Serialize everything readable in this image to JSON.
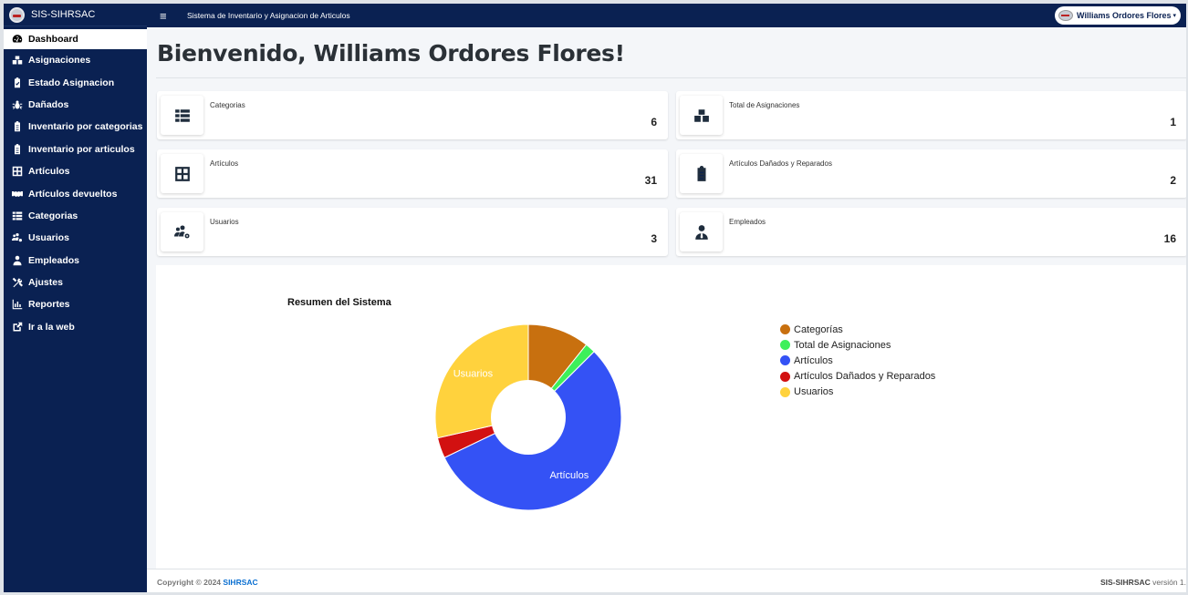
{
  "brand": {
    "name": "SIS-SIHRSAC"
  },
  "topbar": {
    "title": "Sistema de Inventario y Asignacion de Articulos",
    "user_name": "Williams Ordores Flores"
  },
  "sidebar": {
    "items": [
      {
        "label": "Dashboard",
        "icon": "tachometer-icon"
      },
      {
        "label": "Asignaciones",
        "icon": "boxes-icon"
      },
      {
        "label": "Estado Asignacion",
        "icon": "clipboard-check-icon"
      },
      {
        "label": "Dañados",
        "icon": "bug-icon"
      },
      {
        "label": "Inventario por categorias",
        "icon": "clipboard-icon"
      },
      {
        "label": "Inventario por articulos",
        "icon": "clipboard-icon"
      },
      {
        "label": "Artículos",
        "icon": "grid-icon"
      },
      {
        "label": "Artículos devueltos",
        "icon": "handshake-icon"
      },
      {
        "label": "Categorias",
        "icon": "table-list-icon"
      },
      {
        "label": "Usuarios",
        "icon": "users-cog-icon"
      },
      {
        "label": "Empleados",
        "icon": "user-tie-icon"
      },
      {
        "label": "Ajustes",
        "icon": "tools-icon"
      },
      {
        "label": "Reportes",
        "icon": "chart-icon"
      },
      {
        "label": "Ir a la web",
        "icon": "external-link-icon"
      }
    ]
  },
  "main": {
    "welcome": "Bienvenido, Williams Ordores Flores!",
    "cards": [
      {
        "label": "Categorias",
        "value": "6",
        "icon": "table-list-icon"
      },
      {
        "label": "Total de Asignaciones",
        "value": "1",
        "icon": "boxes-icon"
      },
      {
        "label": "Artículos",
        "value": "31",
        "icon": "grid-icon"
      },
      {
        "label": "Artículos Dañados y Reparados",
        "value": "2",
        "icon": "clipboard-icon"
      },
      {
        "label": "Usuarios",
        "value": "3",
        "icon": "users-cog-icon"
      },
      {
        "label": "Empleados",
        "value": "16",
        "icon": "user-tie-icon"
      }
    ]
  },
  "chart_data": {
    "type": "pie",
    "title": "Resumen del Sistema",
    "categories": [
      "Categorías",
      "Total de Asignaciones",
      "Artículos",
      "Artículos Dañados y Reparados",
      "Usuarios"
    ],
    "values": [
      6,
      1,
      31,
      2,
      16
    ],
    "colors": [
      "#c8700f",
      "#3df05a",
      "#3452f5",
      "#d21111",
      "#ffd23d"
    ],
    "slice_labels": [
      {
        "category": "Usuarios",
        "text": "Usuarios"
      },
      {
        "category": "Artículos",
        "text": "Artículos"
      }
    ],
    "donut": true,
    "legend": "right"
  },
  "footer": {
    "copyright": "Copyright © 2024 ",
    "brand": "SIHRSAC",
    "app": "SIS-SIHRSAC",
    "version": " versión 1."
  }
}
